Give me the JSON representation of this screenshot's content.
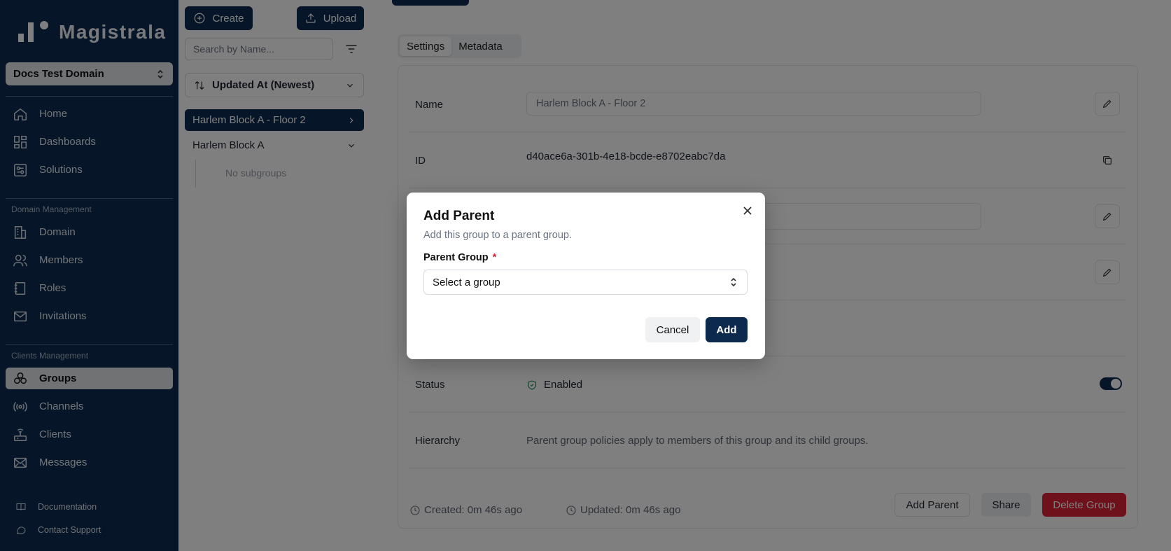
{
  "app": {
    "name": "Magistrala"
  },
  "sidebar": {
    "domain": "Docs Test Domain",
    "main_items": [
      {
        "label": "Home",
        "icon": "home-icon"
      },
      {
        "label": "Dashboards",
        "icon": "dashboard-icon"
      },
      {
        "label": "Solutions",
        "icon": "solutions-icon"
      }
    ],
    "domain_section": "Domain Management",
    "domain_items": [
      {
        "label": "Domain",
        "icon": "building-icon"
      },
      {
        "label": "Members",
        "icon": "users-icon"
      },
      {
        "label": "Roles",
        "icon": "book-icon"
      },
      {
        "label": "Invitations",
        "icon": "mail-icon"
      }
    ],
    "clients_section": "Clients Management",
    "clients_items": [
      {
        "label": "Groups",
        "icon": "groups-icon",
        "active": true
      },
      {
        "label": "Channels",
        "icon": "broadcast-icon"
      },
      {
        "label": "Clients",
        "icon": "router-icon"
      },
      {
        "label": "Messages",
        "icon": "message-icon"
      }
    ],
    "footer": [
      {
        "label": "Documentation",
        "icon": "book-open-icon"
      },
      {
        "label": "Contact Support",
        "icon": "chat-icon"
      }
    ]
  },
  "groups_panel": {
    "create_label": "Create",
    "upload_label": "Upload",
    "search_placeholder": "Search by Name...",
    "sort_label": "Updated At (Newest)",
    "tree": [
      {
        "label": "Harlem Block A - Floor 2",
        "selected": true
      },
      {
        "label": "Harlem Block A",
        "selected": false
      }
    ],
    "no_subgroups": "No subgroups"
  },
  "detail": {
    "tabs": [
      {
        "label": "Settings",
        "active": true
      },
      {
        "label": "Metadata",
        "active": false
      }
    ],
    "name_label": "Name",
    "name_value": "Harlem Block A - Floor 2",
    "id_label": "ID",
    "id_value": "d40ace6a-301b-4e18-bcde-e8702eabc7da",
    "status_label": "Status",
    "status_value": "Enabled",
    "hierarchy_label": "Hierarchy",
    "hierarchy_value": "Parent group policies apply to members of this group and its child groups.",
    "created": "Created: 0m 46s ago",
    "updated": "Updated: 0m 46s ago",
    "add_parent_label": "Add Parent",
    "share_label": "Share",
    "delete_label": "Delete Group"
  },
  "modal": {
    "title": "Add Parent",
    "description": "Add this group to a parent group.",
    "field_label": "Parent Group",
    "required_mark": "*",
    "select_value": "Select a group",
    "cancel_label": "Cancel",
    "add_label": "Add"
  },
  "colors": {
    "brand": "#0c2a4e",
    "danger": "#dc2236",
    "success": "#1f8a5b"
  }
}
